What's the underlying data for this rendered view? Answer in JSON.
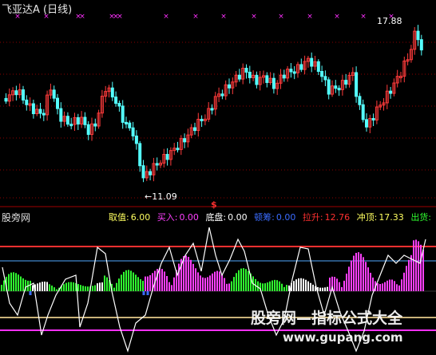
{
  "window": {
    "title": "飞亚达A (日线)"
  },
  "colors": {
    "background": "#000000",
    "up_candle": "#ff3b3b",
    "down_candle": "#54ffff",
    "grid": "#8b0000",
    "signal_x": "#ff30ff",
    "line_top": "#ff3030",
    "line_mid": "#4fa9ff",
    "line_low": "#c9b27a",
    "line_bottom": "#ff30ff",
    "white_line": "#ffffff",
    "bar_green": "#30ff30",
    "bar_magenta": "#ff40ff",
    "bar_white": "#ffffff"
  },
  "price_chart": {
    "peak_label": "17.88",
    "low_label": "←11.09",
    "marker": "$"
  },
  "indicator": {
    "name": "股旁网",
    "fields": [
      {
        "label": "取值:",
        "value": "6.00",
        "color": "#ffff60"
      },
      {
        "label": "买入:",
        "value": "0.00",
        "color": "#ff40ff"
      },
      {
        "label": "底盘:",
        "value": "0.00",
        "color": "#ffffff"
      },
      {
        "label": "顿筹:",
        "value": "0.00",
        "color": "#3a6cff"
      },
      {
        "label": "拉升:",
        "value": "12.76",
        "color": "#ff3030"
      },
      {
        "label": "冲顶:",
        "value": "17.33",
        "color": "#ffff60"
      },
      {
        "label": "出货:",
        "value": "",
        "color": "#30ff30"
      }
    ]
  },
  "watermark": {
    "text": "股旁网—指标公式大全",
    "url": "www.gupang.com"
  }
}
